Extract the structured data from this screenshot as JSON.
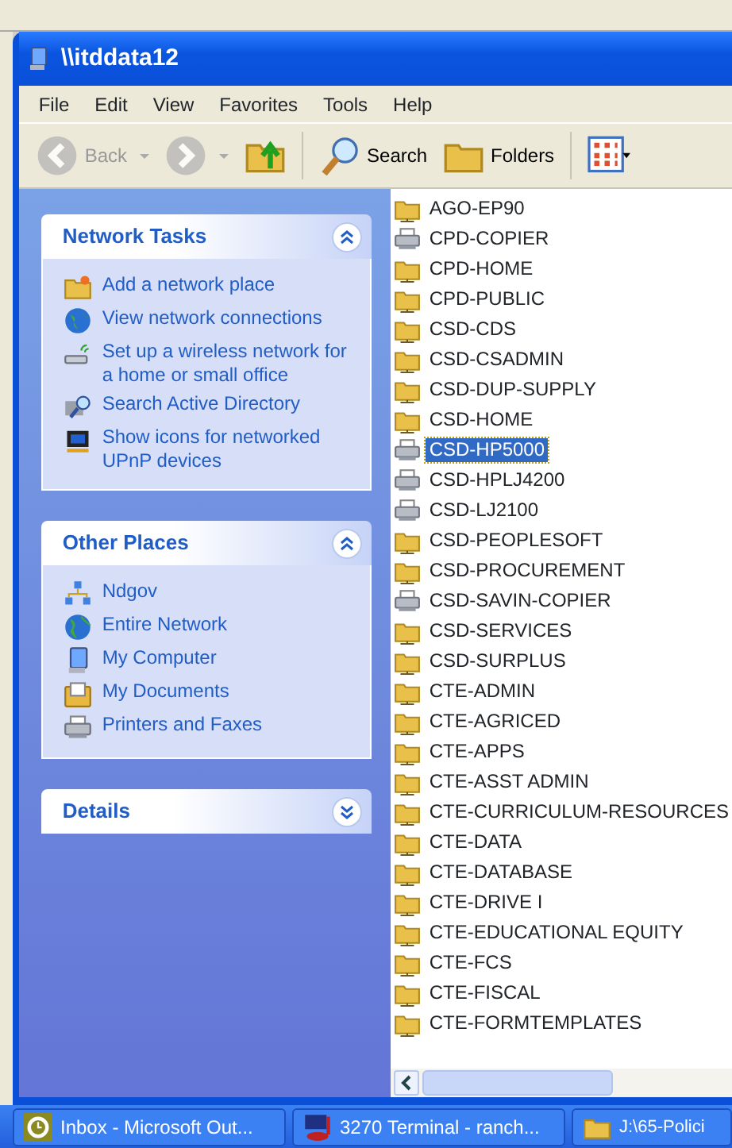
{
  "window": {
    "title": "\\\\itddata12"
  },
  "menu": [
    "File",
    "Edit",
    "View",
    "Favorites",
    "Tools",
    "Help"
  ],
  "toolbar": [
    {
      "kind": "back",
      "label": "Back",
      "disabled": true
    },
    {
      "kind": "forward",
      "disabled": true
    },
    {
      "kind": "up",
      "disabled": false
    },
    {
      "kind": "search",
      "label": "Search",
      "disabled": false
    },
    {
      "kind": "folders",
      "label": "Folders",
      "disabled": false
    },
    {
      "kind": "views",
      "disabled": false
    }
  ],
  "task_panels": [
    {
      "title": "Network Tasks",
      "expanded": true,
      "items": [
        {
          "kind": "add-place",
          "label": "Add a network place"
        },
        {
          "kind": "connections",
          "label": "View network connections"
        },
        {
          "kind": "wireless",
          "label": "Set up a wireless network for a home or small office"
        },
        {
          "kind": "directory",
          "label": "Search Active Directory"
        },
        {
          "kind": "upnp",
          "label": "Show icons for networked UPnP devices"
        }
      ]
    },
    {
      "title": "Other Places",
      "expanded": true,
      "items": [
        {
          "kind": "domain",
          "label": "Ndgov"
        },
        {
          "kind": "globe",
          "label": "Entire Network"
        },
        {
          "kind": "computer",
          "label": "My Computer"
        },
        {
          "kind": "documents",
          "label": "My Documents"
        },
        {
          "kind": "printers",
          "label": "Printers and Faxes"
        }
      ]
    },
    {
      "title": "Details",
      "expanded": false
    }
  ],
  "files": [
    {
      "kind": "share",
      "name": "AGO-EP90",
      "selected": false
    },
    {
      "kind": "printer",
      "name": "CPD-COPIER",
      "selected": false
    },
    {
      "kind": "share",
      "name": "CPD-HOME",
      "selected": false
    },
    {
      "kind": "share",
      "name": "CPD-PUBLIC",
      "selected": false
    },
    {
      "kind": "share",
      "name": "CSD-CDS",
      "selected": false
    },
    {
      "kind": "share",
      "name": "CSD-CSADMIN",
      "selected": false
    },
    {
      "kind": "share",
      "name": "CSD-DUP-SUPPLY",
      "selected": false
    },
    {
      "kind": "share",
      "name": "CSD-HOME",
      "selected": false
    },
    {
      "kind": "printer",
      "name": "CSD-HP5000",
      "selected": true
    },
    {
      "kind": "printer",
      "name": "CSD-HPLJ4200",
      "selected": false
    },
    {
      "kind": "printer",
      "name": "CSD-LJ2100",
      "selected": false
    },
    {
      "kind": "share",
      "name": "CSD-PEOPLESOFT",
      "selected": false
    },
    {
      "kind": "share",
      "name": "CSD-PROCUREMENT",
      "selected": false
    },
    {
      "kind": "printer",
      "name": "CSD-SAVIN-COPIER",
      "selected": false
    },
    {
      "kind": "share",
      "name": "CSD-SERVICES",
      "selected": false
    },
    {
      "kind": "share",
      "name": "CSD-SURPLUS",
      "selected": false
    },
    {
      "kind": "share",
      "name": "CTE-ADMIN",
      "selected": false
    },
    {
      "kind": "share",
      "name": "CTE-AGRICED",
      "selected": false
    },
    {
      "kind": "share",
      "name": "CTE-APPS",
      "selected": false
    },
    {
      "kind": "share",
      "name": "CTE-ASST ADMIN",
      "selected": false
    },
    {
      "kind": "share",
      "name": "CTE-CURRICULUM-RESOURCES",
      "selected": false
    },
    {
      "kind": "share",
      "name": "CTE-DATA",
      "selected": false
    },
    {
      "kind": "share",
      "name": "CTE-DATABASE",
      "selected": false
    },
    {
      "kind": "share",
      "name": "CTE-DRIVE I",
      "selected": false
    },
    {
      "kind": "share",
      "name": "CTE-EDUCATIONAL EQUITY",
      "selected": false
    },
    {
      "kind": "share",
      "name": "CTE-FCS",
      "selected": false
    },
    {
      "kind": "share",
      "name": "CTE-FISCAL",
      "selected": false
    },
    {
      "kind": "share",
      "name": "CTE-FORMTEMPLATES",
      "selected": false
    }
  ],
  "taskbar": [
    {
      "kind": "outlook",
      "label": "Inbox - Microsoft Out..."
    },
    {
      "kind": "terminal",
      "label": "3270 Terminal - ranch..."
    },
    {
      "kind": "folder",
      "label": "J:\\65-Polici"
    }
  ]
}
